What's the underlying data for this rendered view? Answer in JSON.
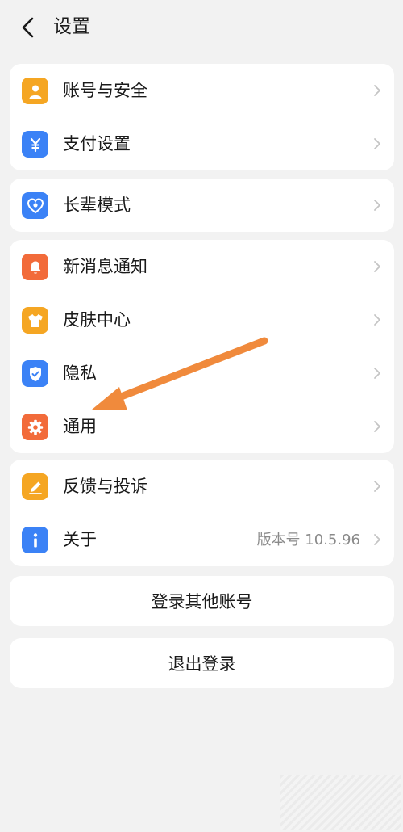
{
  "header": {
    "title": "设置",
    "back_icon": "chevron-left-icon"
  },
  "groups": [
    {
      "items": [
        {
          "label": "账号与安全",
          "icon": "user-icon",
          "color": "#f5a623"
        },
        {
          "label": "支付设置",
          "icon": "yuan-icon",
          "color": "#3b82f6"
        }
      ]
    },
    {
      "items": [
        {
          "label": "长辈模式",
          "icon": "heart-icon",
          "color": "#3b82f6"
        }
      ]
    },
    {
      "items": [
        {
          "label": "新消息通知",
          "icon": "bell-icon",
          "color": "#f26b3a"
        },
        {
          "label": "皮肤中心",
          "icon": "shirt-icon",
          "color": "#f5a623"
        },
        {
          "label": "隐私",
          "icon": "shield-icon",
          "color": "#3b82f6"
        },
        {
          "label": "通用",
          "icon": "gear-icon",
          "color": "#f26b3a"
        }
      ]
    },
    {
      "items": [
        {
          "label": "反馈与投诉",
          "icon": "pencil-icon",
          "color": "#f5a623"
        },
        {
          "label": "关于",
          "icon": "info-icon",
          "color": "#3b82f6",
          "value": "版本号 10.5.96"
        }
      ]
    }
  ],
  "buttons": {
    "switch_account": "登录其他账号",
    "logout": "退出登录"
  },
  "annotation": {
    "arrow_color": "#f08a3c"
  }
}
